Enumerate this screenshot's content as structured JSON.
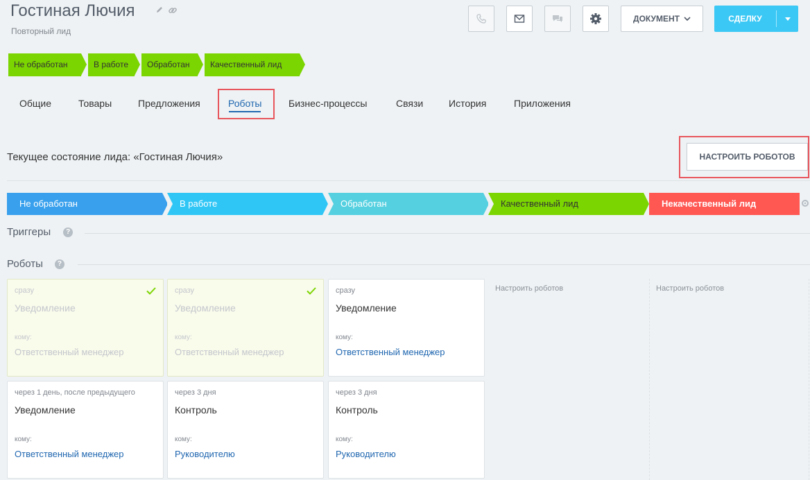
{
  "header": {
    "title": "Гостиная Лючия",
    "subtitle": "Повторный лид",
    "document_label": "ДОКУМЕНТ",
    "deal_label": "СДЕЛКУ"
  },
  "top_stages": [
    {
      "label": "Не обработан"
    },
    {
      "label": "В работе"
    },
    {
      "label": "Обработан"
    },
    {
      "label": "Качественный лид"
    }
  ],
  "tabs": [
    {
      "label": "Общие"
    },
    {
      "label": "Товары"
    },
    {
      "label": "Предложения"
    },
    {
      "label": "Роботы",
      "active": true
    },
    {
      "label": "Бизнес-процессы"
    },
    {
      "label": "Связи"
    },
    {
      "label": "История"
    },
    {
      "label": "Приложения"
    }
  ],
  "lead_state": "Текущее состояние лида: «Гостиная Лючия»",
  "configure_button": "НАСТРОИТЬ РОБОТОВ",
  "stages": [
    {
      "label": "Не обработан",
      "color": "#38a0ed"
    },
    {
      "label": "В работе",
      "color": "#2fc6f6"
    },
    {
      "label": "Обработан",
      "color": "#55d0e0"
    },
    {
      "label": "Качественный лид",
      "color": "#7bd500"
    },
    {
      "label": "Некачественный лид",
      "color": "#ff5752"
    }
  ],
  "sections": {
    "triggers": "Триггеры",
    "robots": "Роботы"
  },
  "robot_cards": [
    {
      "when": "сразу",
      "title": "Уведомление",
      "to_label": "кому:",
      "to": "Ответственный менеджер",
      "done": true
    },
    {
      "when": "сразу",
      "title": "Уведомление",
      "to_label": "кому:",
      "to": "Ответственный менеджер",
      "done": true
    },
    {
      "when": "сразу",
      "title": "Уведомление",
      "to_label": "кому:",
      "to": "Ответственный менеджер",
      "done": false
    },
    {
      "when": "через 1 день, после предыдущего",
      "title": "Уведомление",
      "to_label": "кому:",
      "to": "Ответственный менеджер",
      "done": false
    },
    {
      "when": "через 3 дня",
      "title": "Контроль",
      "to_label": "кому:",
      "to": "Руководителю",
      "done": false
    },
    {
      "when": "через 3 дня",
      "title": "Контроль",
      "to_label": "кому:",
      "to": "Руководителю",
      "done": false
    }
  ],
  "column_hints": [
    "Настроить роботов",
    "Настроить роботов"
  ],
  "colors": {
    "accent": "#3bc8f5",
    "link": "#2067b0",
    "stage_green": "#7bd500",
    "highlight": "#e8555c"
  }
}
